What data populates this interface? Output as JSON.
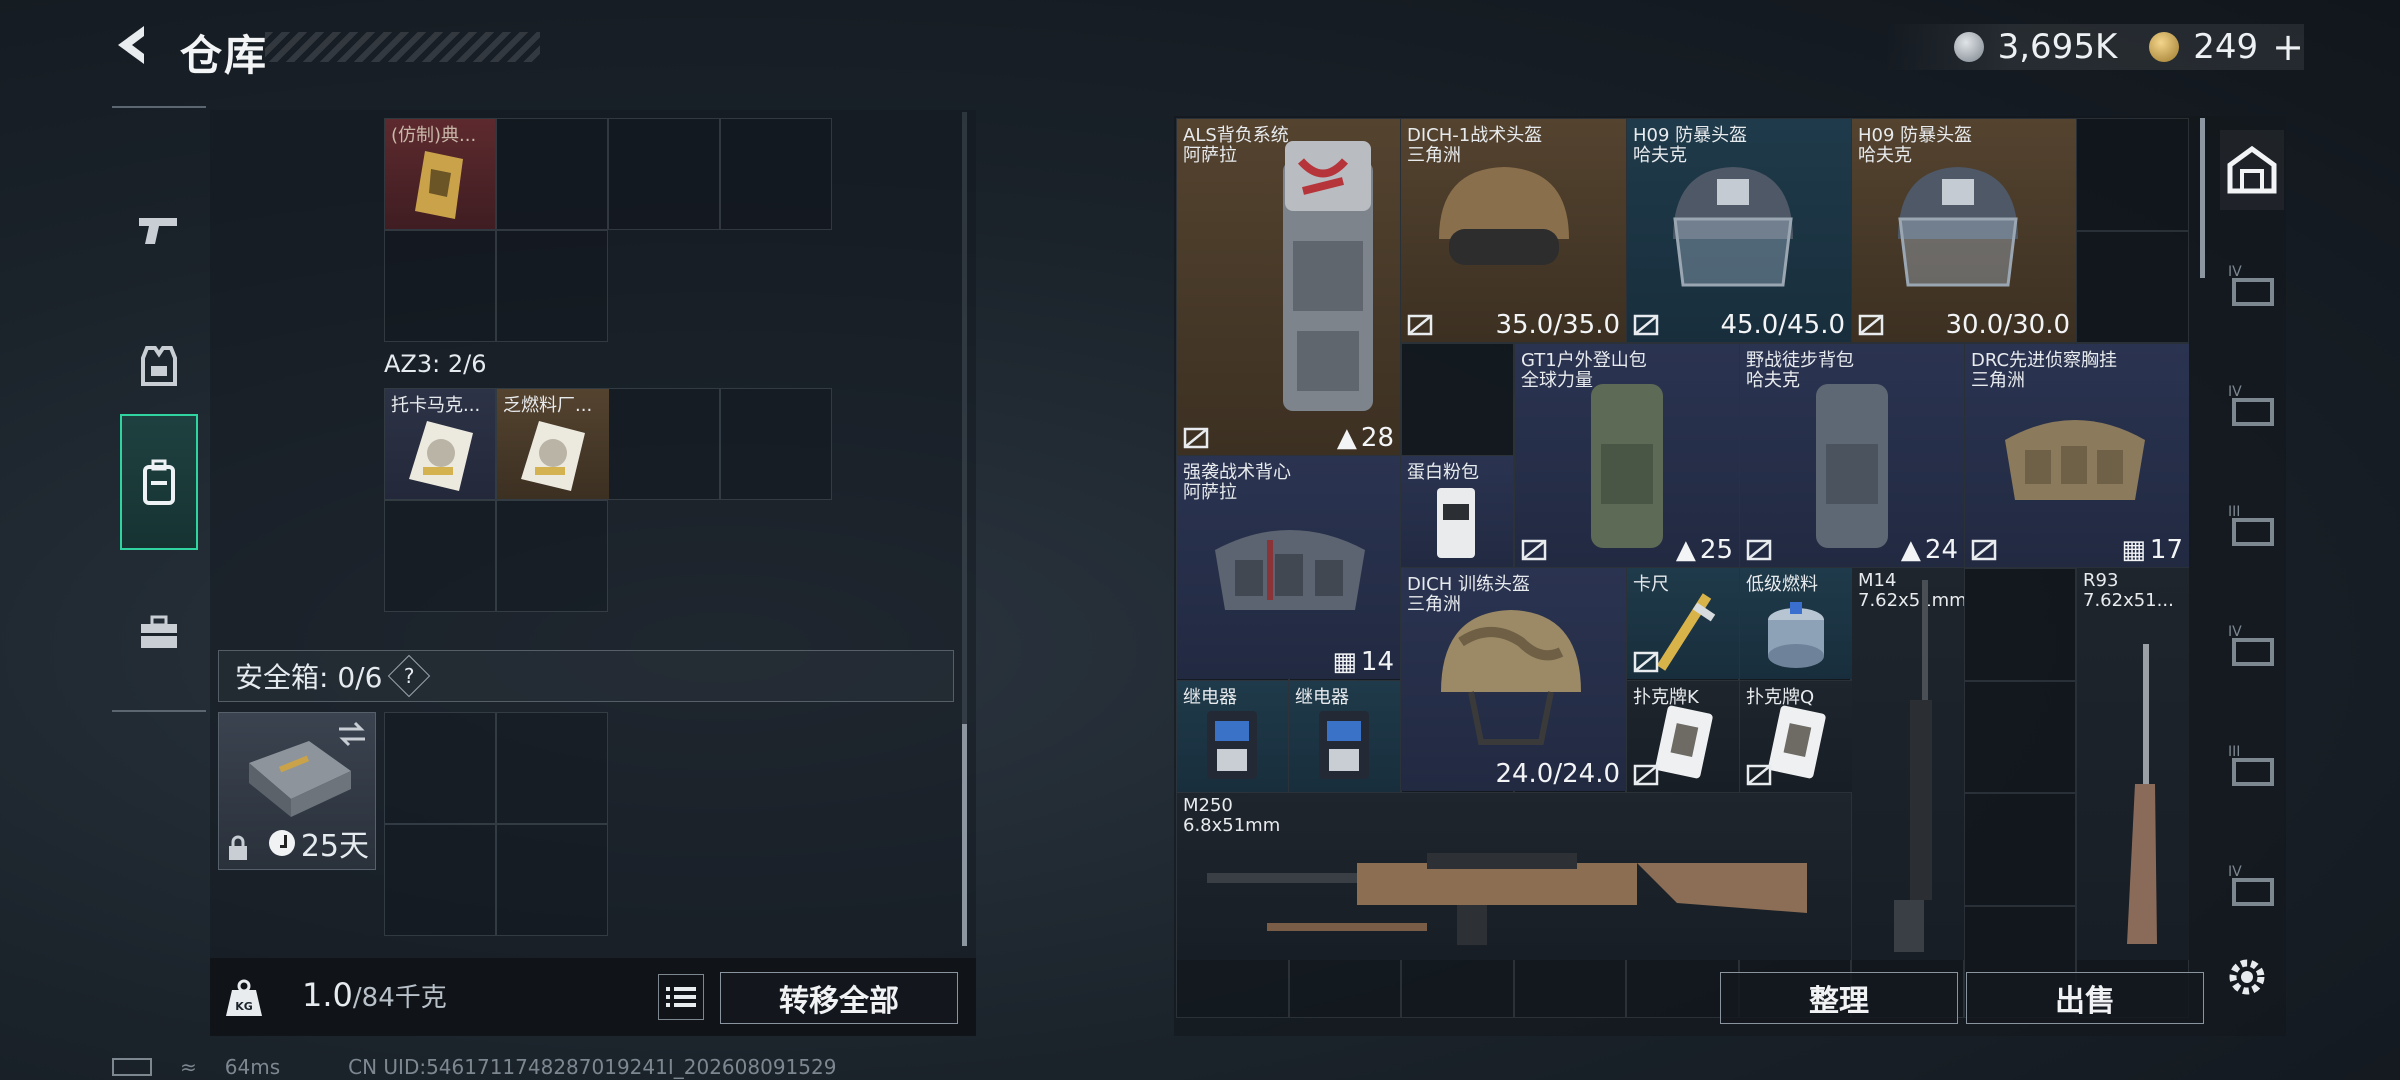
{
  "header": {
    "title": "仓库"
  },
  "currency": {
    "silver_value": "3,695K",
    "gold_value": "249",
    "gold_add": "+"
  },
  "left_panel": {
    "top_item": {
      "name": "(仿制)典..."
    },
    "az3_label": "AZ3: 2/6",
    "az3_items": [
      {
        "name": "托卡马克..."
      },
      {
        "name": "乏燃料厂..."
      }
    ],
    "safe_box": {
      "label": "安全箱: 0/6",
      "help": "?",
      "days": "25天"
    },
    "weight": {
      "current": "1.0",
      "max": "/84千克"
    },
    "transfer_all": "转移全部"
  },
  "right_panel": {
    "items": [
      {
        "key": "als",
        "name": "ALS背负系统",
        "sub": "阿萨拉",
        "value": "28"
      },
      {
        "key": "dich1",
        "name": "DICH-1战术头盔",
        "sub": "三角洲",
        "value": "35.0/35.0"
      },
      {
        "key": "h09a",
        "name": "H09 防暴头盔",
        "sub": "哈夫克",
        "value": "45.0/45.0"
      },
      {
        "key": "h09b",
        "name": "H09 防暴头盔",
        "sub": "哈夫克",
        "value": "30.0/30.0"
      },
      {
        "key": "gt1",
        "name": "GT1户外登山包",
        "sub": "全球力量",
        "value": "25"
      },
      {
        "key": "yezhan",
        "name": "野战徒步背包",
        "sub": "哈夫克",
        "value": "24"
      },
      {
        "key": "drc",
        "name": "DRC先进侦察胸挂",
        "sub": "三角洲",
        "value": "17"
      },
      {
        "key": "qiangxi",
        "name": "强袭战术背心",
        "sub": "阿萨拉",
        "value": "14"
      },
      {
        "key": "danbai",
        "name": "蛋白粉包",
        "sub": "",
        "value": ""
      },
      {
        "key": "dich_train",
        "name": "DICH 训练头盔",
        "sub": "三角洲",
        "value": "24.0/24.0"
      },
      {
        "key": "kachi",
        "name": "卡尺",
        "sub": "",
        "value": ""
      },
      {
        "key": "diji",
        "name": "低级燃料",
        "sub": "",
        "value": ""
      },
      {
        "key": "m14",
        "name": "M14",
        "sub": "7.62x51mm",
        "value": ""
      },
      {
        "key": "r93",
        "name": "R93",
        "sub": "7.62x51...",
        "value": ""
      },
      {
        "key": "relay1",
        "name": "继电器",
        "sub": "",
        "value": ""
      },
      {
        "key": "relay2",
        "name": "继电器",
        "sub": "",
        "value": ""
      },
      {
        "key": "pokerk",
        "name": "扑克牌K",
        "sub": "",
        "value": ""
      },
      {
        "key": "pokerq",
        "name": "扑克牌Q",
        "sub": "",
        "value": ""
      },
      {
        "key": "m250",
        "name": "M250",
        "sub": "6.8x51mm",
        "value": ""
      }
    ],
    "sort_button": "整理",
    "sell_button": "出售"
  },
  "right_sidebar": [
    "IV",
    "IV",
    "III",
    "IV",
    "III",
    "IV"
  ],
  "status_bar": {
    "ping": "64ms",
    "uid": "CN UID:5461711748287019241I_202608091529"
  },
  "colors": {
    "accent": "#2fd4a0",
    "gold": "#c9a24a"
  }
}
